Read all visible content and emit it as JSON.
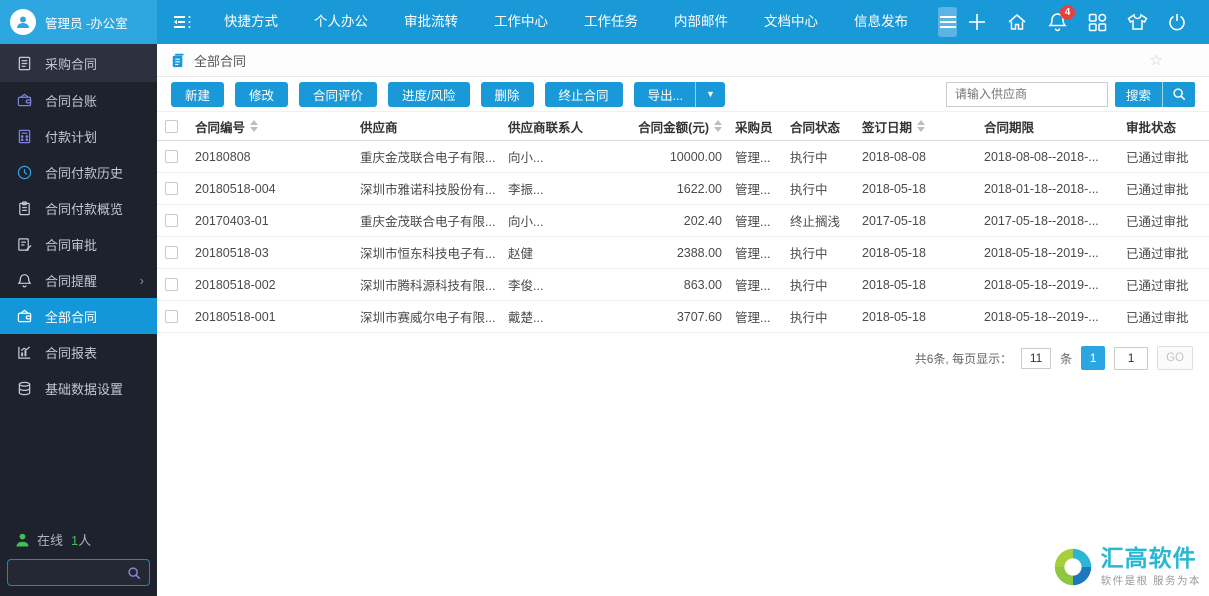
{
  "topbar": {
    "user_name": "管理员 -办公室",
    "menu": [
      "快捷方式",
      "个人办公",
      "审批流转",
      "工作中心",
      "工作任务",
      "内部邮件",
      "文档中心",
      "信息发布"
    ],
    "notification_badge": "4",
    "icons": [
      "plus-icon",
      "home-icon",
      "bell-icon",
      "apps-grid-icon",
      "shirt-icon",
      "power-icon"
    ]
  },
  "sidebar": {
    "items": [
      {
        "label": "采购合同",
        "icon": "contract-doc-icon"
      },
      {
        "label": "合同台账",
        "icon": "wallet-icon"
      },
      {
        "label": "付款计划",
        "icon": "calculator-icon"
      },
      {
        "label": "合同付款历史",
        "icon": "clock-icon"
      },
      {
        "label": "合同付款概览",
        "icon": "clipboard-icon"
      },
      {
        "label": "合同审批",
        "icon": "doc-pen-icon"
      },
      {
        "label": "合同提醒",
        "icon": "bell-icon",
        "expand": "›"
      },
      {
        "label": "全部合同",
        "icon": "wallet-icon"
      },
      {
        "label": "合同报表",
        "icon": "chart-icon"
      },
      {
        "label": "基础数据设置",
        "icon": "database-icon"
      }
    ],
    "online_label": "在线",
    "online_count": "1",
    "online_unit": "人"
  },
  "page": {
    "title": "全部合同"
  },
  "toolbar": {
    "buttons": [
      "新建",
      "修改",
      "合同评价",
      "进度/风险",
      "删除",
      "终止合同"
    ],
    "export_label": "导出...",
    "search_placeholder": "请输入供应商",
    "search_button": "搜索"
  },
  "table": {
    "columns": [
      "合同编号",
      "供应商",
      "供应商联系人",
      "合同金额(元)",
      "采购员",
      "合同状态",
      "签订日期",
      "合同期限",
      "审批状态"
    ],
    "rows": [
      {
        "contract_no": "20180808",
        "supplier": "重庆金茂联合电子有限...",
        "contact": "向小...",
        "amount": "10000.00",
        "buyer": "管理...",
        "status": "执行中",
        "sign_date": "2018-08-08",
        "period": "2018-08-08--2018-...",
        "approval": "已通过审批"
      },
      {
        "contract_no": "20180518-004",
        "supplier": "深圳市雅诺科技股份有...",
        "contact": "李振...",
        "amount": "1622.00",
        "buyer": "管理...",
        "status": "执行中",
        "sign_date": "2018-05-18",
        "period": "2018-01-18--2018-...",
        "approval": "已通过审批"
      },
      {
        "contract_no": "20170403-01",
        "supplier": "重庆金茂联合电子有限...",
        "contact": "向小...",
        "amount": "202.40",
        "buyer": "管理...",
        "status": "终止搁浅",
        "sign_date": "2017-05-18",
        "period": "2017-05-18--2018-...",
        "approval": "已通过审批"
      },
      {
        "contract_no": "20180518-03",
        "supplier": "深圳市恒东科技电子有...",
        "contact": "赵健",
        "amount": "2388.00",
        "buyer": "管理...",
        "status": "执行中",
        "sign_date": "2018-05-18",
        "period": "2018-05-18--2019-...",
        "approval": "已通过审批"
      },
      {
        "contract_no": "20180518-002",
        "supplier": "深圳市腾科源科技有限...",
        "contact": "李俊...",
        "amount": "863.00",
        "buyer": "管理...",
        "status": "执行中",
        "sign_date": "2018-05-18",
        "period": "2018-05-18--2019-...",
        "approval": "已通过审批"
      },
      {
        "contract_no": "20180518-001",
        "supplier": "深圳市赛威尔电子有限...",
        "contact": "戴楚...",
        "amount": "3707.60",
        "buyer": "管理...",
        "status": "执行中",
        "sign_date": "2018-05-18",
        "period": "2018-05-18--2019-...",
        "approval": "已通过审批"
      }
    ]
  },
  "pagination": {
    "summary": "共6条, 每页显示：",
    "page_size": "11",
    "unit": "条",
    "current_page": "1",
    "page_input": "1",
    "go_label": "GO"
  },
  "vendor": {
    "title": "汇高软件",
    "tagline": "软件是根 服务为本"
  },
  "colors": {
    "topbar_blue": "#1a99d8",
    "topbar_left_blue": "#2ea6e0",
    "sidebar_dark": "#1d222d",
    "active_blue": "#1397d8",
    "badge_red": "#e8413c",
    "logo_cyan": "#29b7d4",
    "online_green": "#3fbf58"
  }
}
